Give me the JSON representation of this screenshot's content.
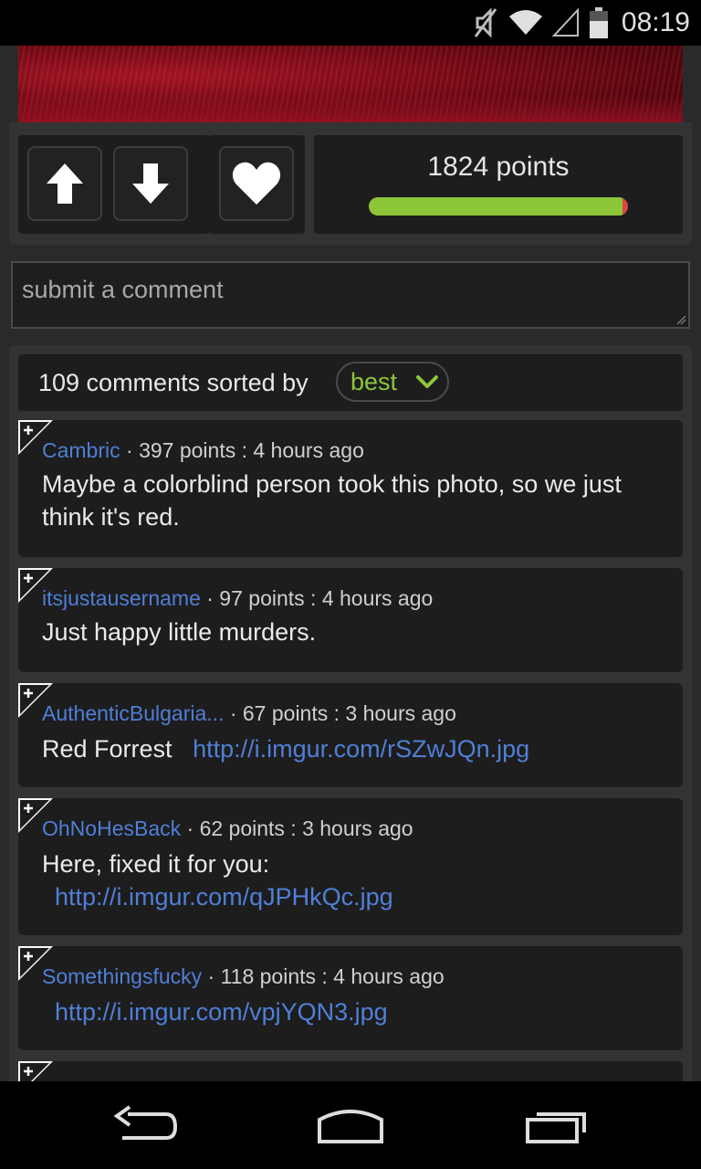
{
  "status_bar": {
    "time": "08:19",
    "icons": [
      "mute-icon",
      "wifi-icon",
      "signal-icon",
      "battery-icon"
    ]
  },
  "post": {
    "points_label": "1824 points",
    "upvote_ratio": 0.98
  },
  "comment_box": {
    "placeholder": "submit a comment"
  },
  "comments_header": {
    "label": "109 comments sorted by",
    "sort_value": "best"
  },
  "comments": [
    {
      "user": "Cambric",
      "meta": " · 397 points : 4 hours ago",
      "line1": "Maybe a colorblind person took this photo, so we just",
      "line2": "think it's red."
    },
    {
      "user": "itsjustausername",
      "meta": " · 97 points : 4 hours ago",
      "line1": "Just happy little murders."
    },
    {
      "user": "AuthenticBulgaria...",
      "meta": " · 67 points : 3 hours ago",
      "text": "Red Forrest",
      "link": "http://i.imgur.com/rSZwJQn.jpg"
    },
    {
      "user": "OhNoHesBack",
      "meta": " · 62 points : 3 hours ago",
      "text": "Here, fixed it for you:",
      "link": "http://i.imgur.com/qJPHkQc.jpg"
    },
    {
      "user": "Somethingsfucky",
      "meta": " · 118 points : 4 hours ago",
      "link": "http://i.imgur.com/vpjYQN3.jpg"
    }
  ],
  "colors": {
    "accent_green": "#8ec63a",
    "link_blue": "#4f7fd8",
    "downvote_red": "#e04545"
  }
}
